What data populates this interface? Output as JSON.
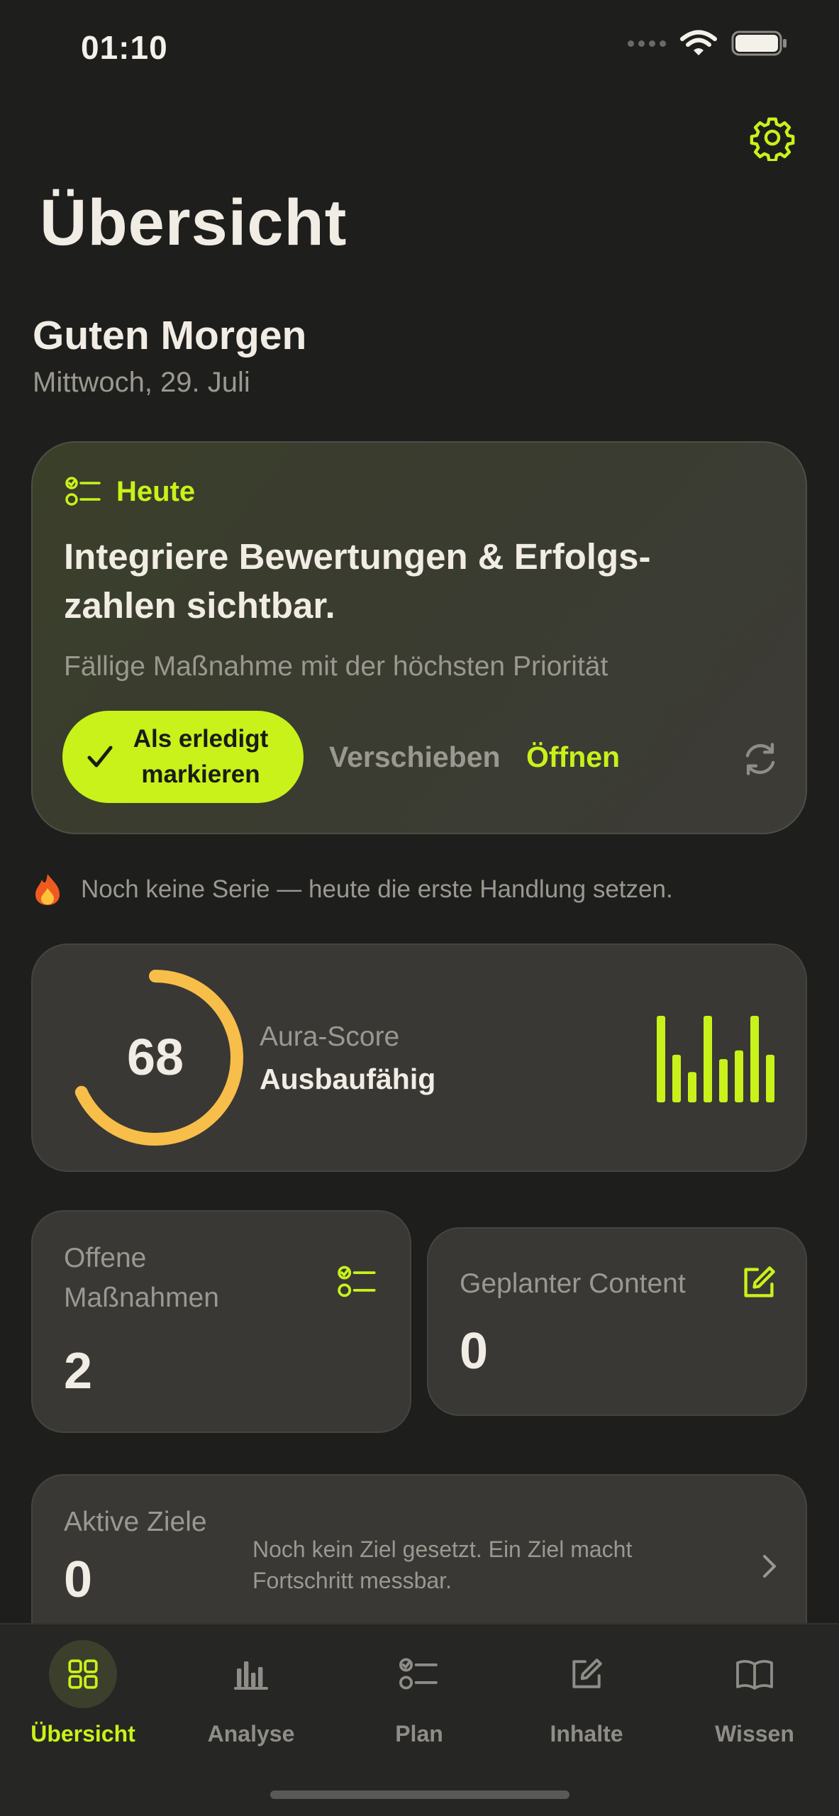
{
  "status_bar": {
    "time": "01:10"
  },
  "header": {
    "title": "Übersicht",
    "settings_icon": "gear-icon"
  },
  "greeting": {
    "title": "Guten Morgen",
    "date": "Mittwoch, 29. Juli"
  },
  "today_card": {
    "label": "Heute",
    "task": "Integriere Bewertungen & Erfolgs-zahlen sichtbar.",
    "subtitle": "Fällige Maßnahme mit der höchsten Priorität",
    "done_label": "Als erledigt markieren",
    "postpone_label": "Verschieben",
    "open_label": "Öffnen"
  },
  "streak": {
    "text": "Noch keine Serie — heute die erste Handlung setzen."
  },
  "aura": {
    "score": "68",
    "score_fraction": 0.68,
    "label": "Aura-Score",
    "status": "Ausbaufähig",
    "bars": [
      1.0,
      0.55,
      0.35,
      1.0,
      0.5,
      0.6,
      1.0,
      0.55
    ]
  },
  "stats": {
    "open_actions": {
      "label": "Offene Maßnahmen",
      "value": "2"
    },
    "planned_content": {
      "label": "Geplanter Content",
      "value": "0"
    },
    "active_goals": {
      "label": "Aktive Ziele",
      "value": "0",
      "hint": "Noch kein Ziel gesetzt. Ein Ziel macht Fortschritt messbar."
    }
  },
  "tabs": [
    {
      "label": "Übersicht",
      "icon": "grid-icon",
      "active": true
    },
    {
      "label": "Analyse",
      "icon": "bar-chart-icon",
      "active": false
    },
    {
      "label": "Plan",
      "icon": "checklist-icon",
      "active": false
    },
    {
      "label": "Inhalte",
      "icon": "edit-icon",
      "active": false
    },
    {
      "label": "Wissen",
      "icon": "book-icon",
      "active": false
    }
  ],
  "colors": {
    "accent": "#c8f21a",
    "ring": "#f8be4a",
    "background": "#1e1e1c"
  }
}
